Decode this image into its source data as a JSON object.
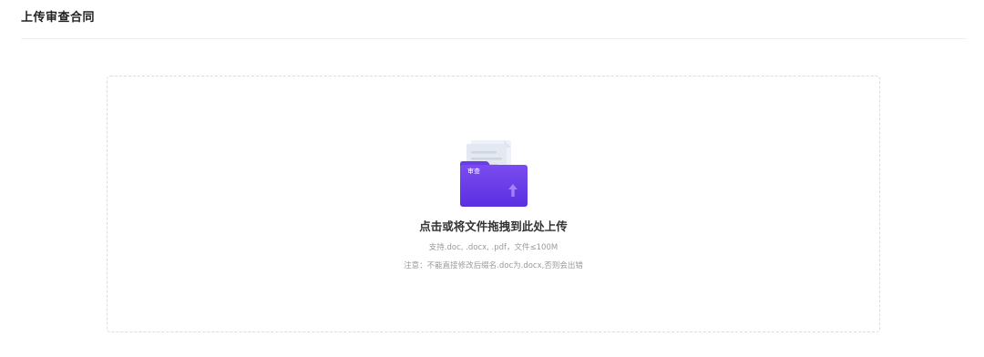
{
  "header": {
    "title": "上传审查合同"
  },
  "upload": {
    "icon": "folder-upload-icon",
    "folder_label": "审查",
    "prompt": "点击或将文件拖拽到此处上传",
    "hint": "支持.doc, .docx, .pdf，文件≤100M",
    "warning": "注意：不能直接修改后缀名.doc为.docx,否则会出错"
  },
  "colors": {
    "folder_purple": "#6c3ce6",
    "folder_purple_light": "#8a5cf5",
    "paper": "#e6ebf3"
  }
}
